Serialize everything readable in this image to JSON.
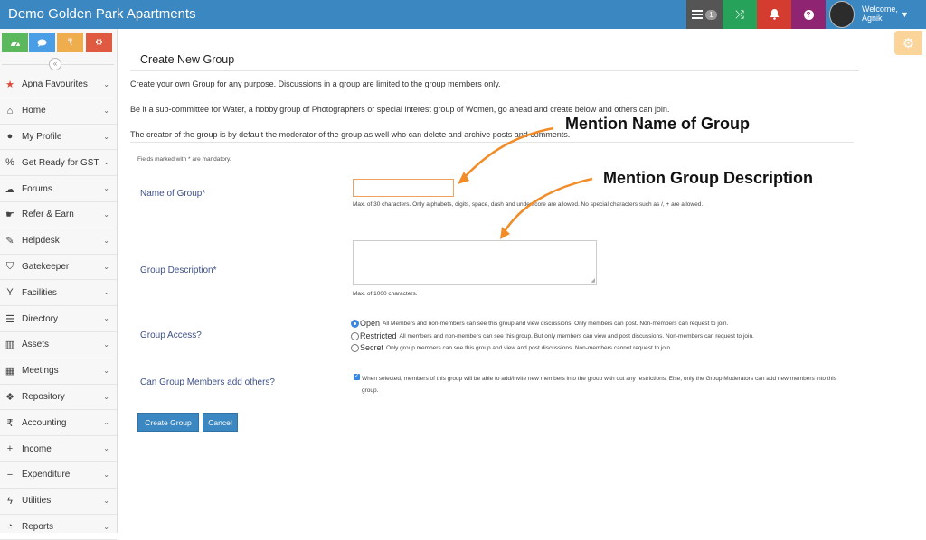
{
  "app": {
    "title": "Demo Golden Park Apartments"
  },
  "topbar": {
    "messages_icon": "list-icon",
    "messages_badge": "1",
    "shuffle_icon": "shuffle-icon",
    "bell_icon": "bell-icon",
    "help_icon": "question-icon",
    "welcome": "Welcome,",
    "user_name": "Agnik",
    "colors": {
      "bar": "#3a87c2",
      "messages": "#555555",
      "shuffle": "#27a25a",
      "bell": "#d33c2e",
      "help": "#8e2472"
    }
  },
  "sidebar": {
    "quick_buttons": [
      {
        "icon": "dashboard-icon",
        "color": "#5cb85c"
      },
      {
        "icon": "chat-icon",
        "color": "#4a9ee6"
      },
      {
        "icon": "rupee-icon",
        "color": "#f0ad4e",
        "glyph": "₹"
      },
      {
        "icon": "cogs-icon",
        "color": "#e05a41"
      }
    ],
    "collapse_glyph": "«",
    "items": [
      {
        "label": "Apna Favourites",
        "icon": "star-icon"
      },
      {
        "label": "Home",
        "icon": "home-icon"
      },
      {
        "label": "My Profile",
        "icon": "user-icon"
      },
      {
        "label": "Get Ready for GST",
        "icon": "percent-icon"
      },
      {
        "label": "Forums",
        "icon": "comments-icon"
      },
      {
        "label": "Refer & Earn",
        "icon": "handshake-icon"
      },
      {
        "label": "Helpdesk",
        "icon": "wrench-icon"
      },
      {
        "label": "Gatekeeper",
        "icon": "shield-icon"
      },
      {
        "label": "Facilities",
        "icon": "glass-icon"
      },
      {
        "label": "Directory",
        "icon": "list-icon"
      },
      {
        "label": "Assets",
        "icon": "building-icon"
      },
      {
        "label": "Meetings",
        "icon": "calendar-icon"
      },
      {
        "label": "Repository",
        "icon": "dropbox-icon"
      },
      {
        "label": "Accounting",
        "icon": "rupee-icon"
      },
      {
        "label": "Income",
        "icon": "plus-icon"
      },
      {
        "label": "Expenditure",
        "icon": "minus-icon"
      },
      {
        "label": "Utilities",
        "icon": "bolt-icon"
      },
      {
        "label": "Reports",
        "icon": "chart-icon"
      }
    ]
  },
  "page": {
    "title": "Create New Group",
    "intro": [
      "Create your own Group for any purpose. Discussions in a group are limited to the group members only.",
      "Be it a sub-committee for Water, a hobby group of Photographers or special interest group of Women, go ahead and create below and others can join.",
      "The creator of the group is by default the moderator of the group as well who can delete and archive posts and comments."
    ],
    "mandatory_note": "Fields marked with * are mandatory."
  },
  "form": {
    "name": {
      "label": "Name of Group*",
      "value": "",
      "help": "Max. of 30 characters. Only alphabets, digits, space, dash and underscore are allowed. No special characters such as /, + are allowed."
    },
    "description": {
      "label": "Group Description*",
      "value": "",
      "help": "Max. of 1000 characters."
    },
    "access": {
      "label": "Group Access?",
      "selected": "Open",
      "options": [
        {
          "name": "Open",
          "desc": "All Members and non-members can see this group and view discussions. Only members can post. Non-members can request to join."
        },
        {
          "name": "Restricted",
          "desc": "All members and non-members can see this group. But only members can view and post discussions. Non-members can request to join."
        },
        {
          "name": "Secret",
          "desc": "Only group members can see this group and view and post discussions. Non-members cannot request to join."
        }
      ]
    },
    "add_others": {
      "label": "Can Group Members add others?",
      "checked": true,
      "text": "When selected, members of this group will be able to add/invite new members into the group with out any restrictions. Else, only the Group Moderators can add new members into this group."
    },
    "buttons": {
      "create": "Create Group",
      "cancel": "Cancel"
    }
  },
  "annotations": {
    "name": "Mention Name of Group",
    "description": "Mention Group Description",
    "arrow_color": "#f28c28"
  }
}
